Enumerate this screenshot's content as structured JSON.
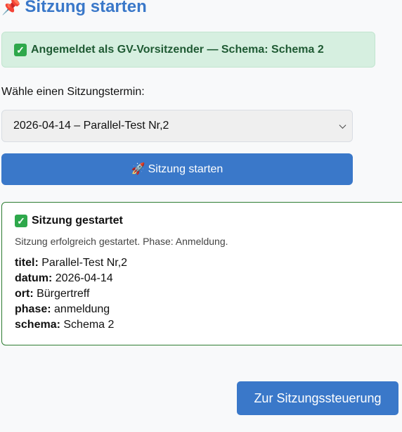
{
  "header": {
    "title": "Sitzung starten",
    "icon": "pushpin-icon"
  },
  "login_status": {
    "text": "Angemeldet als GV-Vorsitzender — Schema: Schema 2",
    "icon": "check-mark-icon",
    "color": "#1f5a33",
    "background": "#d6efe0"
  },
  "session_select": {
    "label": "Wähle einen Sitzungstermin:",
    "selected_value": "2026-04-14 – Parallel-Test Nr,2",
    "icon": "chevron-down-icon"
  },
  "start_button": {
    "label": "Sitzung starten",
    "icon": "rocket-icon",
    "color": "#3a78c9"
  },
  "result": {
    "title": "Sitzung gestartet",
    "message": "Sitzung erfolgreich gestartet. Phase: Anmeldung.",
    "icon": "check-mark-icon",
    "details": [
      {
        "key": "titel:",
        "value": "Parallel-Test Nr,2"
      },
      {
        "key": "datum:",
        "value": "2026-04-14"
      },
      {
        "key": "ort:",
        "value": "Bürgertreff"
      },
      {
        "key": "phase:",
        "value": "anmeldung"
      },
      {
        "key": "schema:",
        "value": "Schema 2"
      }
    ]
  },
  "control_button": {
    "label": "Zur Sitzungssteuerung",
    "color": "#3a78c9"
  }
}
